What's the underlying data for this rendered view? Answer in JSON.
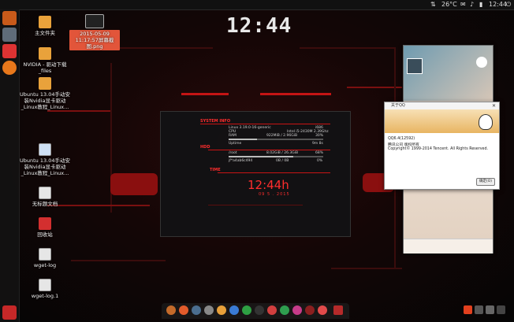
{
  "top_panel": {
    "temperature": "26°C",
    "time": "12:44"
  },
  "desktop_icons": [
    {
      "label": "主文件夹"
    },
    {
      "label": "NVIDIA - 驱动下载_files"
    },
    {
      "label": "Ubuntu 13.04手动安装Nvidia显卡驱动_Linux教程_Linux..."
    },
    {
      "label": "Ubuntu 13.04手动安装Nvidia显卡驱动_Linux教程_Linux..."
    },
    {
      "label": "无标题文档"
    },
    {
      "label": "回收站"
    },
    {
      "label": "wget-log"
    },
    {
      "label": "wget-log.1"
    }
  ],
  "selected_file": {
    "label": "2015-05-09 11:17:57屏幕截图.png"
  },
  "clock_widget": {
    "time": "12:44"
  },
  "system_monitor": {
    "sections": {
      "info": "SYSTEM INFO",
      "hdd": "HDD",
      "time": "TIME"
    },
    "rows": [
      {
        "left": "Linux 3.19.0-16-generic",
        "right": "i686"
      },
      {
        "left": "CPU",
        "mid": "Intel i5-2430M 2.39Ghz",
        "right": ""
      },
      {
        "left": "RAM",
        "mid": "922MiB / 2.96GiB",
        "right": "30%"
      },
      {
        "left": "Uptime",
        "mid": "",
        "right": "9m 8s"
      }
    ],
    "ram_fraction": 0.3,
    "hdd_rows": [
      {
        "left": "/root",
        "mid": "8.02GiB / 26.3GiB",
        "right": "68%"
      },
      {
        "left": "jf*a4ab6c494",
        "mid": "0B / 0B",
        "right": "0%"
      }
    ],
    "root_fraction": 0.68,
    "time": "12:44h",
    "date": "09 5 . 2015"
  },
  "about_dialog": {
    "title": "关于QQ",
    "version": "QQ6.4(12592)",
    "company": "腾讯公司 版权所有",
    "copyright": "Copyright© 1999-2014 Tencent. All Rights Reserved.",
    "ok_button": "确定(O)"
  },
  "colors": {
    "accent_red": "#ff2d2d",
    "panel_bg": "#111111",
    "folder": "#e9a23b"
  }
}
